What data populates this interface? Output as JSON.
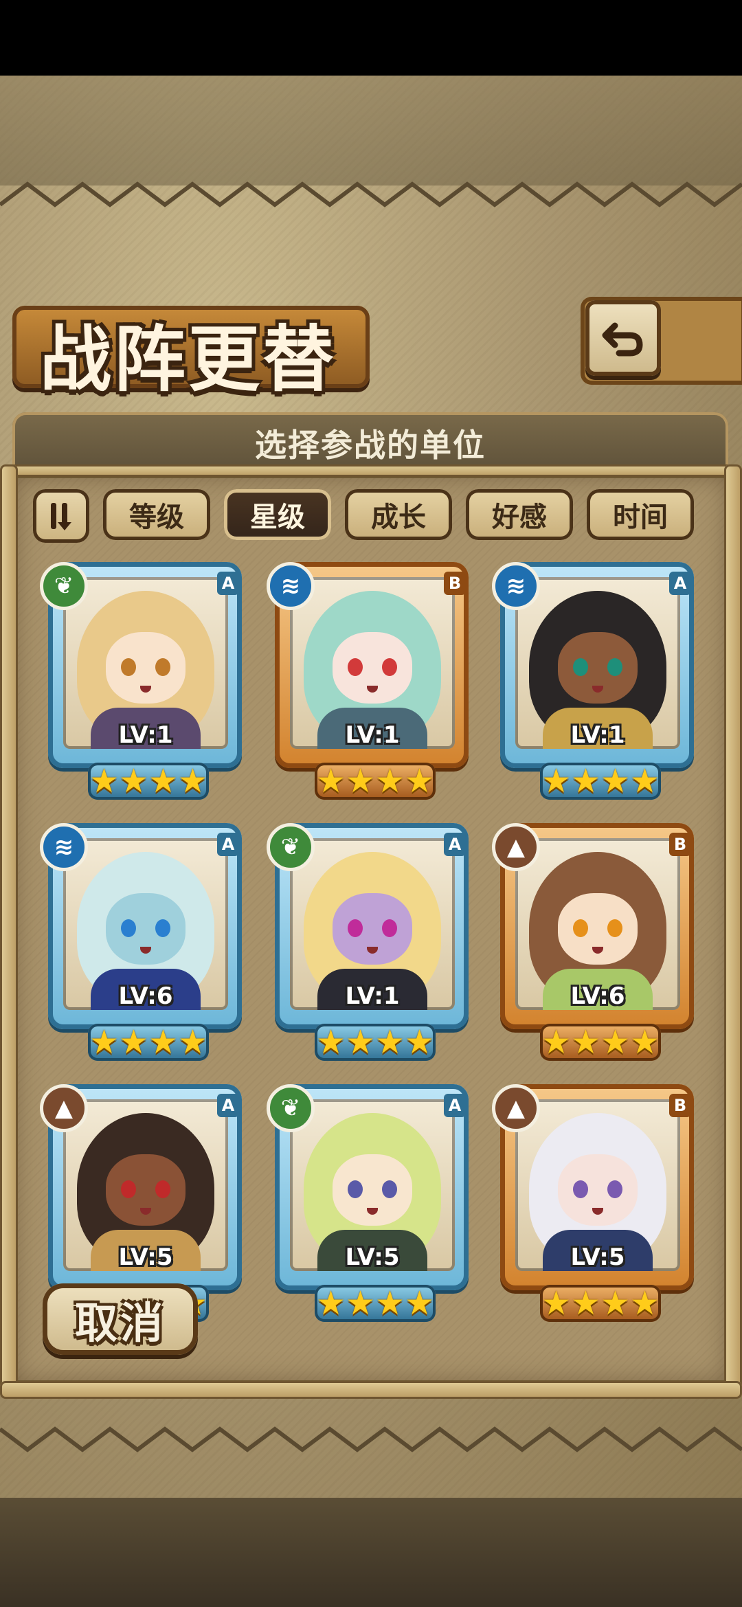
{
  "header": {
    "title": "战阵更替",
    "subtitle": "选择参战的单位",
    "back_icon": "return-arrow-icon"
  },
  "sort_bar": {
    "order_icon": "sort-order-icon",
    "tabs": [
      {
        "label": "等级",
        "active": false
      },
      {
        "label": "星级",
        "active": true
      },
      {
        "label": "成长",
        "active": false
      },
      {
        "label": "好感",
        "active": false
      },
      {
        "label": "时间",
        "active": false
      }
    ]
  },
  "units": [
    {
      "rank": "A",
      "element": "leaf",
      "level": "LV:1",
      "stars": 4,
      "hair": "#e9c98a",
      "skin": "#f9e3cc",
      "eye": "#c07a2a",
      "outfit": "#5b4a6e"
    },
    {
      "rank": "B",
      "element": "water",
      "level": "LV:1",
      "stars": 4,
      "hair": "#9ed8c8",
      "skin": "#f8e4dc",
      "eye": "#d23a3a",
      "outfit": "#4b6a78"
    },
    {
      "rank": "A",
      "element": "water",
      "level": "LV:1",
      "stars": 4,
      "hair": "#2a2626",
      "skin": "#8d5a3a",
      "eye": "#1e8f7a",
      "outfit": "#c8a24a"
    },
    {
      "rank": "A",
      "element": "water",
      "level": "LV:6",
      "stars": 4,
      "hair": "#cfe9ea",
      "skin": "#9fd0dc",
      "eye": "#2a7fd0",
      "outfit": "#2b3e8a"
    },
    {
      "rank": "A",
      "element": "leaf",
      "level": "LV:1",
      "stars": 4,
      "hair": "#f2d88a",
      "skin": "#bfa2d6",
      "eye": "#c02c9a",
      "outfit": "#2a2a33"
    },
    {
      "rank": "B",
      "element": "earth",
      "level": "LV:6",
      "stars": 4,
      "hair": "#8a5a3a",
      "skin": "#f7dfc6",
      "eye": "#e6901a",
      "outfit": "#a8c868"
    },
    {
      "rank": "A",
      "element": "earth",
      "level": "LV:5",
      "stars": 4,
      "hair": "#3a2a22",
      "skin": "#8a5236",
      "eye": "#c02a2a",
      "outfit": "#c79a52"
    },
    {
      "rank": "A",
      "element": "leaf",
      "level": "LV:5",
      "stars": 4,
      "hair": "#d6e48a",
      "skin": "#f8e6cf",
      "eye": "#5a5aa8",
      "outfit": "#3a4a3a"
    },
    {
      "rank": "B",
      "element": "earth",
      "level": "LV:5",
      "stars": 4,
      "hair": "#ecebf2",
      "skin": "#f6e2dc",
      "eye": "#7a5ab0",
      "outfit": "#2e3d6a"
    }
  ],
  "element_glyphs": {
    "leaf": "❦",
    "water": "≋",
    "earth": "▲"
  },
  "cancel_label": "取消",
  "colors": {
    "rank_a_frame": "#6cb6d8",
    "rank_b_frame": "#d2822d",
    "star": "#ffcc1a",
    "active_tab": "#33241a"
  }
}
